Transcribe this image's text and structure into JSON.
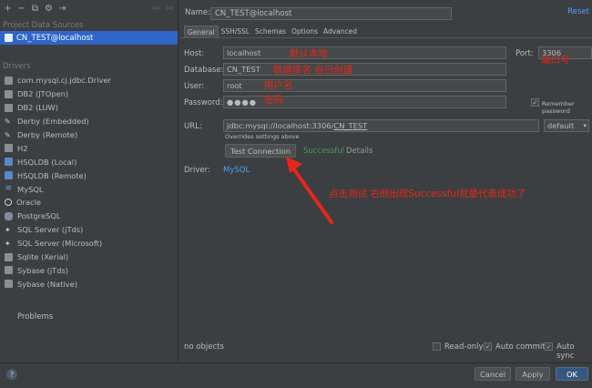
{
  "sidebar": {
    "toolbar": [
      "+",
      "−",
      "copy",
      "settings",
      "export",
      "back",
      "forward"
    ],
    "project_title": "Project Data Sources",
    "selected_source": "CN_TEST@localhost",
    "drivers_title": "Drivers",
    "drivers": [
      "com.mysql.cj.jdbc.Driver",
      "DB2 (JTOpen)",
      "DB2 (LUW)",
      "Derby (Embedded)",
      "Derby (Remote)",
      "H2",
      "HSQLDB (Local)",
      "HSQLDB (Remote)",
      "MySQL",
      "Oracle",
      "PostgreSQL",
      "SQL Server (jTds)",
      "SQL Server (Microsoft)",
      "Sqlite (Xerial)",
      "Sybase (jTds)",
      "Sybase (Native)"
    ],
    "problems_label": "Problems"
  },
  "header": {
    "name_label": "Name:",
    "name_value": "CN_TEST@localhost",
    "reset_label": "Reset"
  },
  "tabs": [
    "General",
    "SSH/SSL",
    "Schemas",
    "Options",
    "Advanced"
  ],
  "form": {
    "host_label": "Host:",
    "host_value": "localhost",
    "port_label": "Port:",
    "port_value": "3306",
    "database_label": "Database:",
    "database_value": "CN_TEST",
    "user_label": "User:",
    "user_value": "root",
    "password_label": "Password:",
    "password_value": "●●●●",
    "remember_label": "Remember password",
    "url_label": "URL:",
    "url_value": "jdbc:mysql://localhost:3306/CN_TEST",
    "url_mode": "default",
    "overrides_note": "Overrides settings above",
    "test_button": "Test Connection",
    "success_text": "Successful",
    "details_label": "Details",
    "driver_label": "Driver:",
    "driver_value": "MySQL"
  },
  "annotations": {
    "host": "默认本地",
    "port": "端口号",
    "database": "数据库名 自己创建",
    "user": "用户名",
    "password": "密码",
    "test": "点击测试   右侧出现Successful就是代表成功了"
  },
  "footer_panel": {
    "status": "no objects",
    "readonly_label": "Read-only",
    "autocommit_label": "Auto commit",
    "autosync_label": "Auto sync"
  },
  "buttons": {
    "help": "?",
    "cancel": "Cancel",
    "apply": "Apply",
    "ok": "OK"
  }
}
